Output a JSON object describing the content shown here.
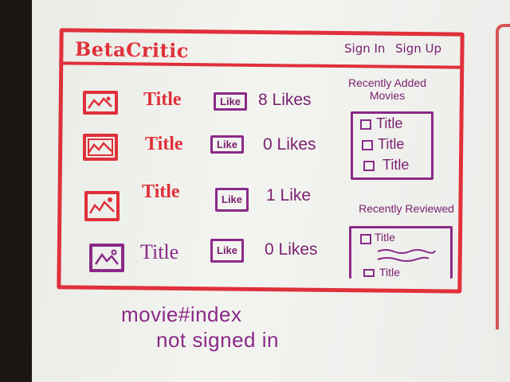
{
  "header": {
    "brand": "BetaCritic",
    "sign_in": "Sign In",
    "sign_up": "Sign Up"
  },
  "movies": [
    {
      "title": "Title",
      "like_label": "Like",
      "likes_text": "8 Likes"
    },
    {
      "title": "Title",
      "like_label": "Like",
      "likes_text": "0 Likes"
    },
    {
      "title": "Title",
      "like_label": "Like",
      "likes_text": "1 Like"
    },
    {
      "title": "Title",
      "like_label": "Like",
      "likes_text": "0 Likes"
    }
  ],
  "sidebar": {
    "recently_added": {
      "heading": "Recently Added Movies",
      "items": [
        "Title",
        "Title",
        "Title"
      ]
    },
    "recently_reviewed": {
      "heading": "Recently Reviewed",
      "items": [
        "Title",
        "Title"
      ]
    }
  },
  "annotation": {
    "line1": "movie#index",
    "line2": "not signed in"
  },
  "colors": {
    "red_marker": "#e0303a",
    "purple_marker": "#8a2a88",
    "whiteboard": "#eef0eb"
  }
}
